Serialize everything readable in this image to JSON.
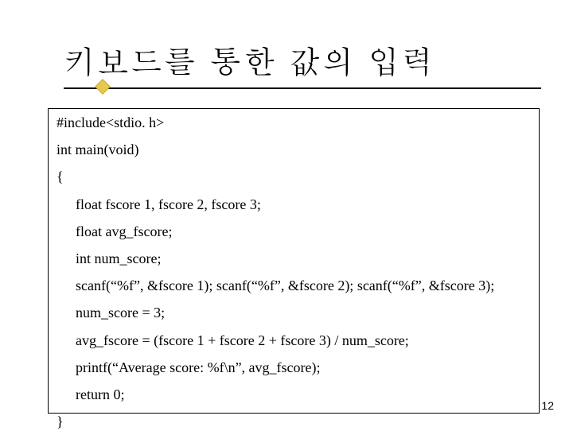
{
  "title": "키보드를 통한 값의 입력",
  "code": {
    "l1": "#include<stdio. h>",
    "l2": "int main(void)",
    "l3": "{",
    "l4": "float fscore 1, fscore 2, fscore 3;",
    "l5": "float avg_fscore;",
    "l6": "int num_score;",
    "l7": "scanf(“%f”, &fscore 1); scanf(“%f”, &fscore 2); scanf(“%f”, &fscore 3);",
    "l8": "num_score = 3;",
    "l9": "avg_fscore = (fscore 1 + fscore 2 + fscore 3) / num_score;",
    "l10": "printf(“Average score: %f\\n”, avg_fscore);",
    "l11": "return 0;",
    "l12": "}"
  },
  "page_number": "12"
}
